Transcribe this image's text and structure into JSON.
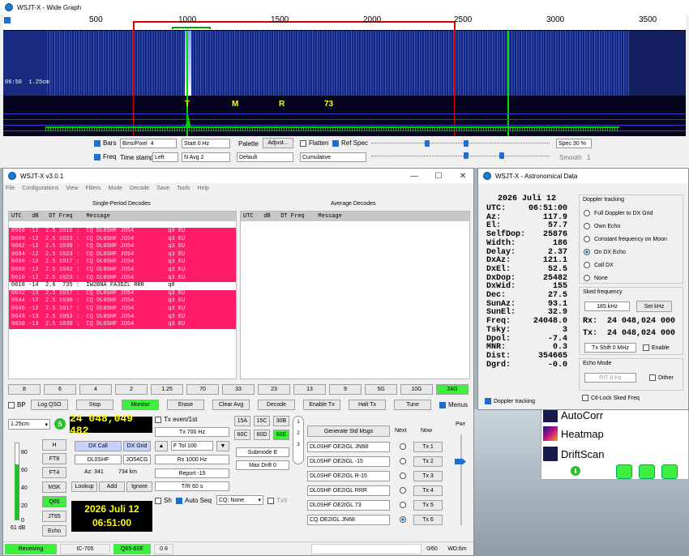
{
  "wide_graph": {
    "title": "WSJT-X - Wide Graph",
    "freq_ticks": [
      "500",
      "1000",
      "1500",
      "2000",
      "2500",
      "3000",
      "3500"
    ],
    "time_label": "06:50  1.25cm",
    "tmr": [
      "T",
      "M",
      "R",
      "73"
    ],
    "bars_label": "Bars",
    "bins_label": "Bins/Pixel",
    "bins_value": "4",
    "start_value": "Start 0 Hz",
    "palette_label": "Palette",
    "adjust_label": "Adjust...",
    "flatten_label": "Flatten",
    "refspec_label": "Ref Spec",
    "spec_value": "Spec 30 %",
    "freq_label": "Freq",
    "timestamp_label": "Time stamp",
    "timestamp_value": "Left",
    "navg_value": "N Avg 2",
    "palette_value": "Default",
    "cumulative_value": "Cumulative",
    "smooth_label": "Smooth",
    "smooth_value": "1"
  },
  "main": {
    "title": "WSJT-X   v3.0.1",
    "menu": [
      "File",
      "Configurations",
      "View",
      "Filters",
      "Mode",
      "Decode",
      "Save",
      "Tools",
      "Help"
    ],
    "single_title": "Single-Period Decodes",
    "average_title": "Average Decodes",
    "header": "UTC   dB   DT Freq    Message",
    "decodes": [
      {
        "text": "0558 -12  2.5 1016 :  CQ DL0SHF JO54          q3 EU",
        "cq": true
      },
      {
        "text": "0600 -12  2.5 1023 :  CQ DL0SHF JO54          q3 EU",
        "cq": true
      },
      {
        "text": "0602 -12  2.5 1038 :  CQ DL0SHF JO54          q3 EU",
        "cq": true
      },
      {
        "text": "0604 -12  2.5 1023 :  CQ DL0SHF JO54          q3 EU",
        "cq": true
      },
      {
        "text": "0606 -12  2.5 1017 :  CQ DL0SHF JO54          q3 EU",
        "cq": true
      },
      {
        "text": "0608 -12  2.5 1042 :  CQ DL0SHF JO54          q3 EU",
        "cq": true
      },
      {
        "text": "0610 -12  2.5 1023 :  CQ DL0SHF JO54          q3 EU",
        "cq": true
      },
      {
        "text": "0618 -14  2.6  735 :  IW2BNA FA3DZL RRR       q0",
        "cq": false
      },
      {
        "text": "0642 -13  2.5 1037 :  CQ DL0SHF JO54          q3 EU",
        "cq": true
      },
      {
        "text": "0644 -12  2.5 1030 :  CQ DL0SHF JO54          q3 EU",
        "cq": true
      },
      {
        "text": "0646 -12  2.5 1017 :  CQ DL0SHF JO54          q3 EU",
        "cq": true
      },
      {
        "text": "0648 -13  2.5 1053 :  CQ DL0SHF JO54          q3 EU",
        "cq": true
      },
      {
        "text": "0650 -13  2.5 1030 :  CQ DL0SHF JO54          q3 EU",
        "cq": true
      }
    ],
    "bands": [
      "8",
      "6",
      "4",
      "2",
      "1.25",
      "70",
      "33",
      "23",
      "13",
      "9",
      "5G",
      "10G",
      "24G"
    ],
    "bp_label": "BP",
    "log_qso": "Log QSO",
    "stop": "Stop",
    "monitor": "Monitor",
    "erase": "Erase",
    "clear_avg": "Clear Avg",
    "decode": "Decode",
    "enable_tx": "Enable Tx",
    "halt_tx": "Halt Tx",
    "tune": "Tune",
    "menus_label": "Menus",
    "band_select": "1.25cm",
    "freq_display": "24 048,049 482",
    "tx_even": "Tx even/1st",
    "tx_hz": "Tx  700  Hz",
    "ftol": "F Tol  100",
    "rx_hz": "Rx  1000  Hz",
    "report": "Report  -15",
    "tr": "T/R  60  s",
    "sh_label": "Sh",
    "auto_seq": "Auto Seq",
    "cq_none": "CQ: None",
    "tx6_label": "Tx6",
    "submodes": [
      "15A",
      "15C",
      "30B",
      "60C",
      "60D",
      "60E"
    ],
    "submode": "Submode E",
    "max_drift": "Max Drift  0",
    "dx_call_btn": "DX Call",
    "dx_grid_btn": "DX Grid",
    "dx_call": "DL0SHF",
    "dx_grid": "JO54CG",
    "az": "Az: 341",
    "dist": "734 km",
    "lookup": "Lookup",
    "add": "Add",
    "ignore": "Ignore",
    "modes": [
      "H",
      "FT8",
      "FT4",
      "MSK",
      "Q65",
      "JT65",
      "Echo"
    ],
    "meter_ticks": [
      "80",
      "60",
      "40",
      "20",
      "0"
    ],
    "meter_db": "61 dB",
    "date": "2026 Juli 12",
    "time": "06:51:00",
    "gen_std": "Generate Std Msgs",
    "next_label": "Next",
    "now_label": "Now",
    "tx_msgs": [
      "DL0SHF OE2IGL JN68",
      "DL0SHF OE2IGL -15",
      "DL0SHF OE2IGL R-15",
      "DL0SHF OE2IGL RRR",
      "DL0SHF OE2IGL 73",
      "CQ OE2IGL JN68"
    ],
    "tx_btns": [
      "Tx 1",
      "Tx 2",
      "Tx 3",
      "Tx 4",
      "Tx 5",
      "Tx 6"
    ],
    "pwr_label": "Pwr",
    "status": {
      "receiving": "Receiving",
      "rig": "IC-705",
      "mode": "Q65-60E",
      "num": "0  8",
      "count": "0/60",
      "wd": "WD:6m"
    }
  },
  "astro": {
    "title": "WSJT-X - Astronomical Data",
    "date": "2026 Juli 12",
    "rows": [
      [
        "UTC:",
        "06:51:00"
      ],
      [
        "Az:",
        "117.9"
      ],
      [
        "El:",
        "57.7"
      ],
      [
        "SelfDop:",
        "25876"
      ],
      [
        "Width:",
        "186"
      ],
      [
        "Delay:",
        "2.37"
      ],
      [
        "DxAz:",
        "121.1"
      ],
      [
        "DxEl:",
        "52.5"
      ],
      [
        "DxDop:",
        "25482"
      ],
      [
        "DxWid:",
        "155"
      ],
      [
        "Dec:",
        "27.5"
      ],
      [
        "SunAz:",
        "93.1"
      ],
      [
        "SunEl:",
        "32.9"
      ],
      [
        "Freq:",
        "24048.0"
      ],
      [
        "Tsky:",
        "3"
      ],
      [
        "Dpol:",
        "-7.4"
      ],
      [
        "MNR:",
        "0.3"
      ],
      [
        "Dist:",
        "354665"
      ],
      [
        "Dgrd:",
        "-0.0"
      ]
    ],
    "doppler_title": "Doppler tracking",
    "doppler_options": [
      "Full Doppler to DX Grid",
      "Own Echo",
      "Constant frequency on Moon",
      "On DX Echo",
      "Call DX",
      "None"
    ],
    "sked_title": "Sked frequency",
    "sked_khz": "185  kHz",
    "set_khz": "Set kHz",
    "rx_freq": "Rx:  24 048,024 000",
    "tx_freq": "Tx:  24 048,024 000",
    "tx_shift": "Tx Shift  0  MHz",
    "enable": "Enable",
    "echo_title": "Echo Mode",
    "rit": "RIT  0  Hz",
    "dither": "Dither",
    "ctl_lock": "Ctl-Lock Sked Freq",
    "doppler_tracking": "Doppler tracking"
  },
  "bg_panel": {
    "items": [
      "AutoCorr",
      "Heatmap",
      "DriftScan"
    ]
  }
}
